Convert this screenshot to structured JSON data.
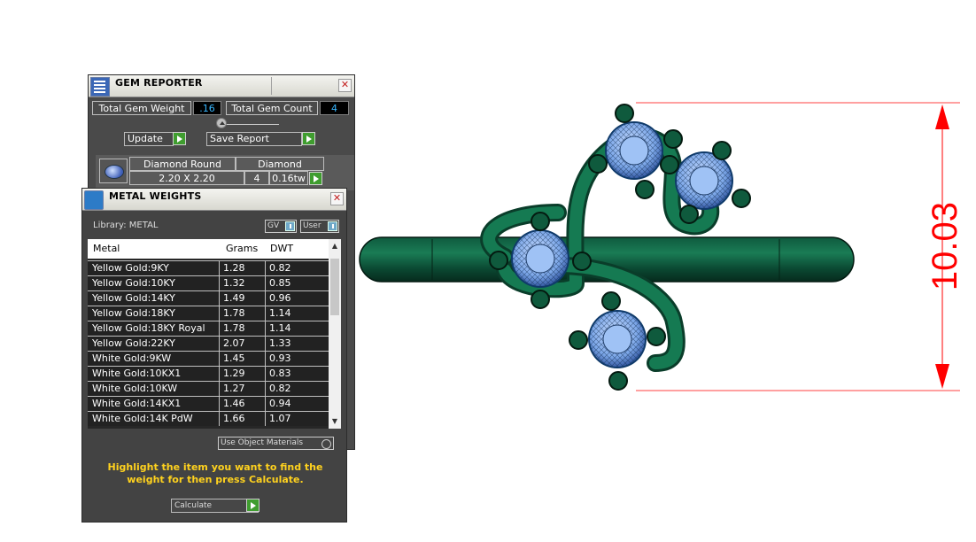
{
  "gem_reporter": {
    "title": "GEM REPORTER",
    "total_weight_label": "Total Gem Weight",
    "total_weight_value": ".16",
    "total_count_label": "Total Gem Count",
    "total_count_value": "4",
    "update_label": "Update",
    "save_report_label": "Save Report",
    "gem": {
      "shape": "Diamond Round",
      "type": "Diamond",
      "size": "2.20 X 2.20",
      "count": "4",
      "weight": "0.16tw"
    }
  },
  "metal_weights": {
    "title": "METAL WEIGHTS",
    "library_label": "Library: METAL",
    "gv_label": "GV",
    "user_label": "User",
    "columns": [
      "Metal",
      "Grams",
      "DWT"
    ],
    "rows": [
      {
        "metal": "Yellow Gold:9KY",
        "grams": "1.28",
        "dwt": "0.82"
      },
      {
        "metal": "Yellow Gold:10KY",
        "grams": "1.32",
        "dwt": "0.85"
      },
      {
        "metal": "Yellow Gold:14KY",
        "grams": "1.49",
        "dwt": "0.96"
      },
      {
        "metal": "Yellow Gold:18KY",
        "grams": "1.78",
        "dwt": "1.14"
      },
      {
        "metal": "Yellow Gold:18KY Royal",
        "grams": "1.78",
        "dwt": "1.14"
      },
      {
        "metal": "Yellow Gold:22KY",
        "grams": "2.07",
        "dwt": "1.33"
      },
      {
        "metal": "White Gold:9KW",
        "grams": "1.45",
        "dwt": "0.93"
      },
      {
        "metal": "White Gold:10KX1",
        "grams": "1.29",
        "dwt": "0.83"
      },
      {
        "metal": "White Gold:10KW",
        "grams": "1.27",
        "dwt": "0.82"
      },
      {
        "metal": "White Gold:14KX1",
        "grams": "1.46",
        "dwt": "0.94"
      },
      {
        "metal": "White Gold:14K PdW",
        "grams": "1.66",
        "dwt": "1.07"
      }
    ],
    "use_object_materials_label": "Use Object Materials",
    "instructions": "Highlight the item you want to find the weight for then press Calculate.",
    "calculate_label": "Calculate"
  },
  "viewport": {
    "dimension_text": "10.03",
    "dimension_color": "#ff0000",
    "ring_color": "#14694a",
    "gem_color": "#8ab4f0"
  }
}
